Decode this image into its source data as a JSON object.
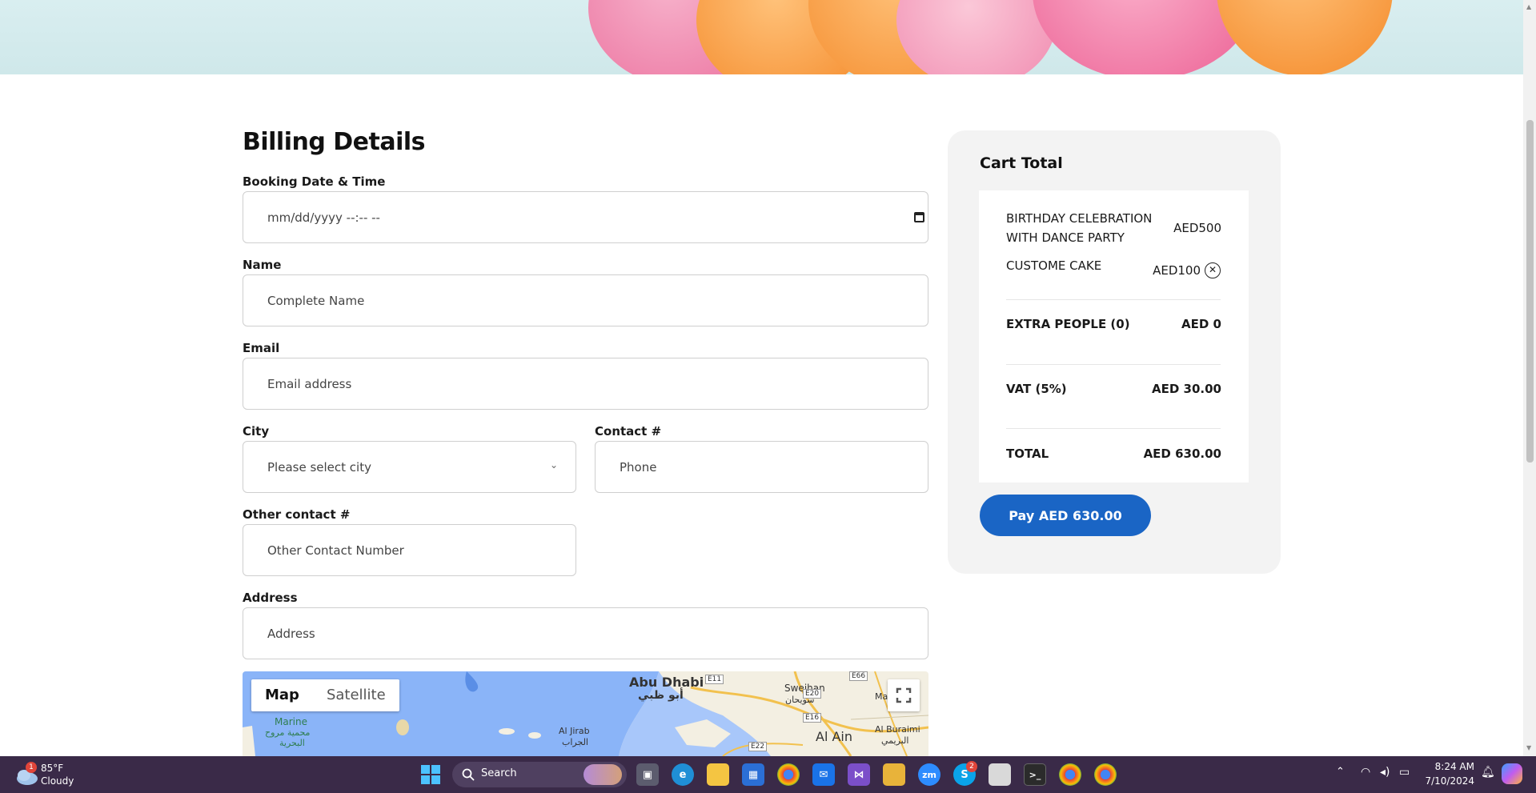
{
  "billing": {
    "title": "Billing Details",
    "booking": {
      "label": "Booking Date & Time",
      "placeholder": "mm/dd/yyyy --:-- --"
    },
    "name": {
      "label": "Name",
      "placeholder": "Complete Name"
    },
    "email": {
      "label": "Email",
      "placeholder": "Email address"
    },
    "city": {
      "label": "City",
      "selected": "Please select city"
    },
    "contact": {
      "label": "Contact #",
      "placeholder": "Phone"
    },
    "other_contact": {
      "label": "Other contact #",
      "placeholder": "Other Contact Number"
    },
    "address": {
      "label": "Address",
      "placeholder": "Address"
    }
  },
  "map": {
    "tabs": [
      "Map",
      "Satellite"
    ],
    "labels": [
      "Abu Dhabi",
      "أبو ظبي",
      "Sweihan",
      "سويحان",
      "Al Ain",
      "Al Buraimi",
      "البريمي",
      "Al Jirab",
      "الجراب",
      "Marine",
      "محمية مروح",
      "البحرية",
      "Ma",
      "E11",
      "E66",
      "E20",
      "E16",
      "E22"
    ]
  },
  "cart": {
    "title": "Cart Total",
    "items": [
      {
        "name_line1": "BIRTHDAY CELEBRATION",
        "name_line2": "WITH DANCE PARTY",
        "price": "AED500"
      },
      {
        "name": "CUSTOME CAKE",
        "price": "AED100"
      }
    ],
    "extra_people": {
      "label": "EXTRA PEOPLE (0)",
      "value": "AED 0"
    },
    "vat": {
      "label": "VAT (5%)",
      "value": "AED 30.00"
    },
    "total": {
      "label": "TOTAL",
      "value": "AED 630.00"
    },
    "pay_button": "Pay AED 630.00"
  },
  "taskbar": {
    "weather_temp": "85°F",
    "weather_desc": "Cloudy",
    "weather_badge": "1",
    "search_label": "Search",
    "time": "8:24 AM",
    "date": "7/10/2024",
    "skype_badge": "2"
  },
  "colors": {
    "accent": "#1a65c5",
    "taskbar": "#3a2a48",
    "cart_bg": "#f3f3f3"
  }
}
